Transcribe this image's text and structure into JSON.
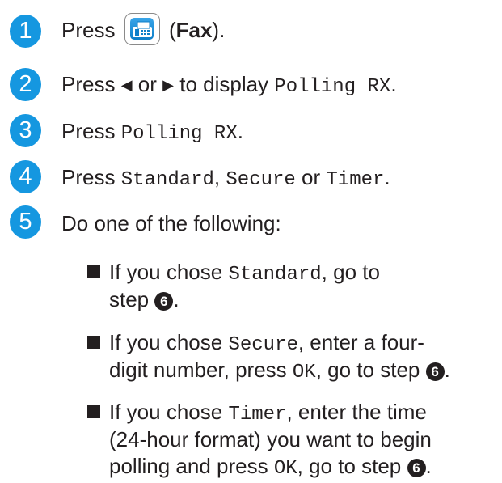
{
  "steps": [
    {
      "number": "1",
      "press": "Press",
      "key_paren_open": "(",
      "key_label": "Fax",
      "key_paren_close": ").",
      "icon": "fax-icon"
    },
    {
      "number": "2",
      "t1": "Press",
      "left_arrow": "◀",
      "t2": "or",
      "right_arrow": "▶",
      "t3": "to display",
      "code1": "Polling RX",
      "t4": "."
    },
    {
      "number": "3",
      "t1": "Press",
      "code1": "Polling RX",
      "t2": "."
    },
    {
      "number": "4",
      "t1": "Press",
      "code1": "Standard",
      "t2": ",",
      "code2": "Secure",
      "t3": "or",
      "code3": "Timer",
      "t4": "."
    },
    {
      "number": "5",
      "t1": "Do one of the following:"
    }
  ],
  "bullets": [
    {
      "t1": "If you chose",
      "code1": "Standard",
      "t2": ", go to",
      "t3": "step",
      "ref": "6",
      "t4": "."
    },
    {
      "t1": "If you chose",
      "code1": "Secure",
      "t2": ", enter a four-",
      "t3": "digit number, press",
      "code2": "OK",
      "t4": ", go to step",
      "ref": "6",
      "t5": "."
    },
    {
      "t1": "If you chose",
      "code1": "Timer",
      "t2": ", enter the time",
      "line2": "(24-hour format) you want to begin",
      "t3": "polling and press",
      "code2": "OK",
      "t4": ", go to step",
      "ref": "6",
      "t5": "."
    }
  ],
  "colors": {
    "badge": "#1597e0",
    "text": "#231f20"
  }
}
